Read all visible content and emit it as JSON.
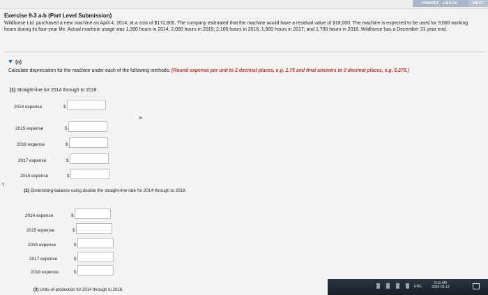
{
  "toolbar": {
    "print_label": "PRINTER VERSION",
    "back_label": "◂ BACK",
    "next_label": "NEXT"
  },
  "exercise": {
    "title": "Exercise 9-3 a-b (Part Level Submission)",
    "description": "Wildhorse Ltd. purchased a new machine on April 4, 2014, at a cost of $172,800. The company estimated that the machine would have a residual value of $18,000. The machine is expected to be used for 9,000 working hours during its four-year life. Actual machine usage was 1,300 hours in 2014; 2,000 hours in 2015; 2,100 hours in 2016; 1,900 hours in 2017; and 1,700 hours in 2018. Wildhorse has a December 31 year end."
  },
  "part_a": {
    "label": "(a)",
    "instruction_plain": "Calculate depreciation for the machine under each of the following methods: ",
    "instruction_red": "(Round expense per unit to 2 decimal places, e.g. 2.75 and final answers to 0 decimal places, e.g. 5,275.)",
    "section1": {
      "title_num": "(1)",
      "title": " Straight-line for 2014 through to 2018.",
      "rows": [
        {
          "label": "2014 expense",
          "currency": "$",
          "value": ""
        },
        {
          "label": "2015 expense",
          "currency": "$",
          "value": ""
        },
        {
          "label": "2016 expense",
          "currency": "$",
          "value": ""
        },
        {
          "label": "2017 expense",
          "currency": "$",
          "value": ""
        },
        {
          "label": "2018 expense",
          "currency": "$",
          "value": ""
        }
      ]
    },
    "section2": {
      "title_num": "(2)",
      "title": " Diminishing-balance using double the straight-line rate for 2014 through to 2018.",
      "rows": [
        {
          "label": "2014 expense",
          "currency": "$",
          "value": ""
        },
        {
          "label": "2015 expense",
          "currency": "$",
          "value": ""
        },
        {
          "label": "2016 expense",
          "currency": "$",
          "value": ""
        },
        {
          "label": "2017 expense",
          "currency": "$",
          "value": ""
        },
        {
          "label": "2018 expense",
          "currency": "$",
          "value": ""
        }
      ]
    },
    "section3": {
      "title_num": "(3)",
      "title": " Units-of-production for 2014 through to 2018."
    }
  },
  "side_mark": "Y",
  "taskbar": {
    "lang": "ENG",
    "time": "8:11 AM",
    "date": "2020-06-12"
  }
}
